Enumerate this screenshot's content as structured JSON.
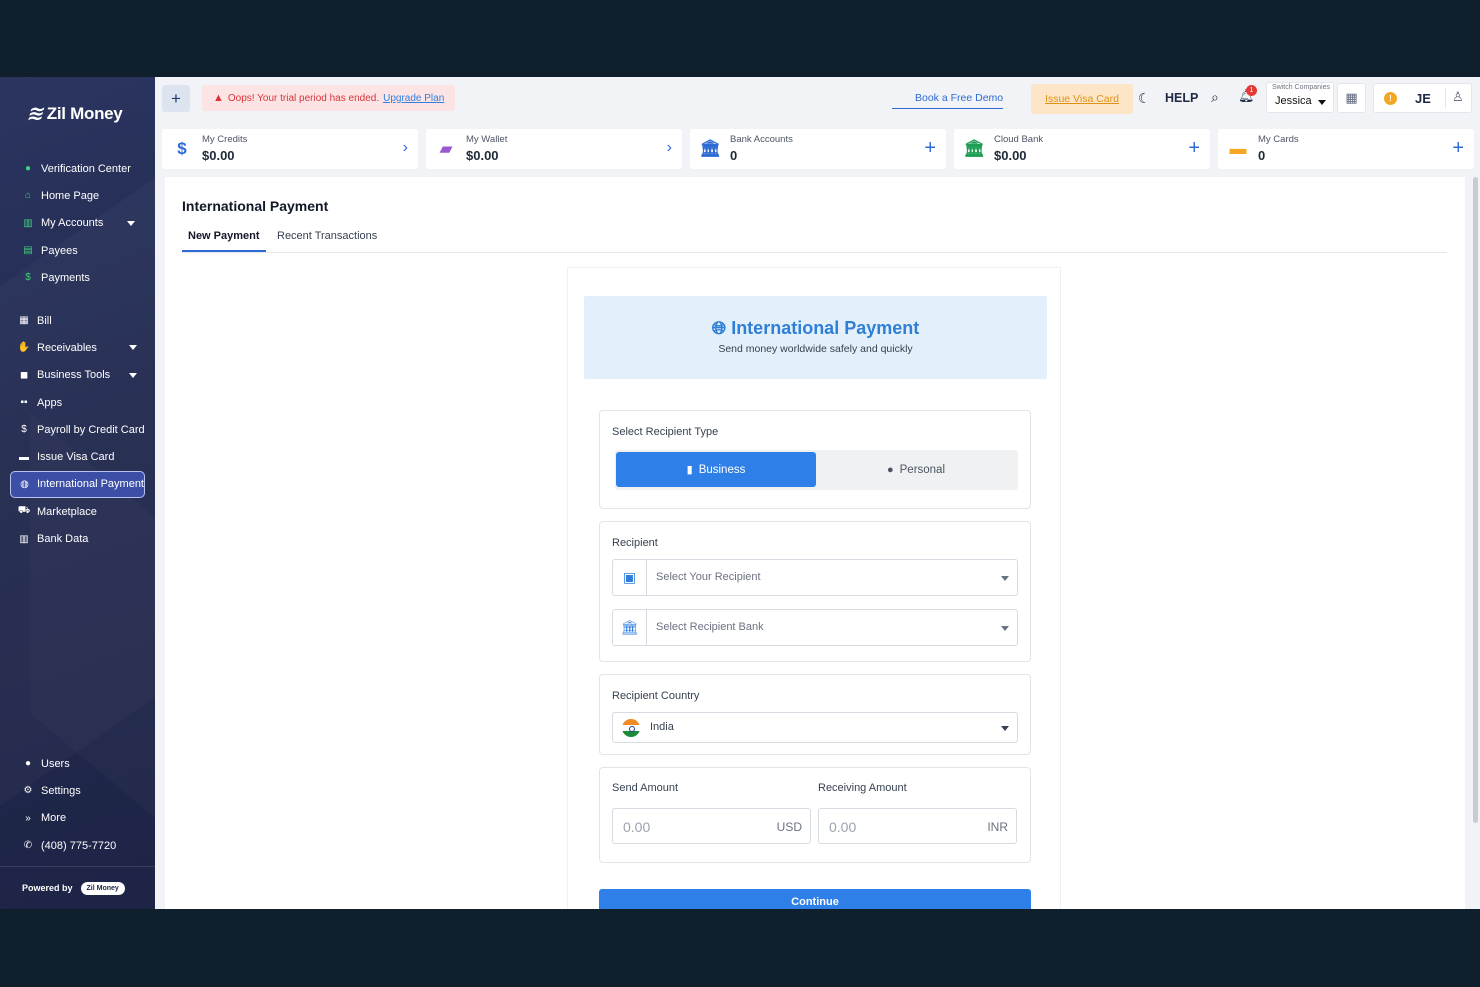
{
  "sidebar": {
    "brand": "Zil Money",
    "items_top": [
      {
        "label": "Verification Center",
        "icon": "check-circle-icon"
      },
      {
        "label": "Home Page",
        "icon": "home-icon"
      },
      {
        "label": "My Accounts",
        "icon": "bank-icon"
      },
      {
        "label": "Payees",
        "icon": "contact-book-icon"
      },
      {
        "label": "Payments",
        "icon": "dollar-icon"
      }
    ],
    "items_mid": [
      {
        "label": "Bill",
        "icon": "document-icon"
      },
      {
        "label": "Receivables",
        "icon": "hand-coin-icon"
      },
      {
        "label": "Business Tools",
        "icon": "briefcase-icon"
      },
      {
        "label": "Apps",
        "icon": "grid-icon"
      },
      {
        "label": "Payroll by Credit Card",
        "icon": "dollar-icon"
      },
      {
        "label": "Issue Visa Card",
        "icon": "credit-card-icon"
      },
      {
        "label": "International Payment",
        "icon": "globe-icon"
      },
      {
        "label": "Marketplace",
        "icon": "cart-icon"
      },
      {
        "label": "Bank Data",
        "icon": "bank-icon"
      }
    ],
    "items_bottom": [
      {
        "label": "Users",
        "icon": "user-icon"
      },
      {
        "label": "Settings",
        "icon": "gear-icon"
      },
      {
        "label": "More",
        "icon": "double-chevron-icon"
      },
      {
        "label": "(408) 775-7720",
        "icon": "phone-icon"
      }
    ],
    "powered_by": "Powered by",
    "powered_badge": "Zil Money"
  },
  "topbar": {
    "trial_message": "Oops! Your trial period has ended.",
    "upgrade_link": "Upgrade Plan",
    "book_demo": "Book a Free Demo",
    "issue_visa": "Issue Visa Card",
    "help": "HELP",
    "notification_count": "1",
    "switch_label": "Switch Companies",
    "company": "Jessica",
    "user_initials": "JE"
  },
  "cards": [
    {
      "label": "My Credits",
      "value": "$0.00"
    },
    {
      "label": "My Wallet",
      "value": "$0.00"
    },
    {
      "label": "Bank Accounts",
      "value": "0"
    },
    {
      "label": "Cloud Bank",
      "value": "$0.00"
    },
    {
      "label": "My Cards",
      "value": "0"
    }
  ],
  "page": {
    "title": "International Payment",
    "tabs": [
      "New Payment",
      "Recent Transactions"
    ]
  },
  "form": {
    "hero_title": "International Payment",
    "hero_subtitle": "Send money worldwide safely and quickly",
    "recipient_type_label": "Select Recipient Type",
    "business_label": "Business",
    "personal_label": "Personal",
    "recipient_label": "Recipient",
    "recipient_placeholder": "Select Your Recipient",
    "bank_placeholder": "Select Recipient Bank",
    "country_label": "Recipient Country",
    "country_value": "India",
    "send_label": "Send Amount",
    "send_value": "0.00",
    "send_currency": "USD",
    "receive_label": "Receiving Amount",
    "receive_value": "0.00",
    "receive_currency": "INR",
    "continue_label": "Continue"
  },
  "colors": {
    "accent": "#2f7fe8",
    "sidebar": "#222a4f",
    "active_item": "#3c4fa6",
    "success": "#3fd179",
    "warning": "#f2a623",
    "error": "#d9343a"
  }
}
